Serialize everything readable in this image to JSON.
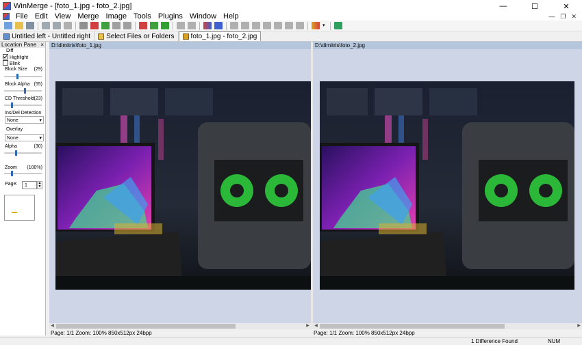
{
  "window": {
    "title": "WinMerge - [foto_1.jpg - foto_2.jpg]",
    "minimize": "—",
    "maximize": "☐",
    "close": "✕"
  },
  "menu": [
    "File",
    "Edit",
    "View",
    "Merge",
    "Image",
    "Tools",
    "Plugins",
    "Window",
    "Help"
  ],
  "mdi": {
    "minimize": "—",
    "restore": "❐",
    "close": "✕"
  },
  "tabs": [
    {
      "label": "Untitled left - Untitled right",
      "icon": "compare-icon"
    },
    {
      "label": "Select Files or Folders",
      "icon": "folder-icon"
    },
    {
      "label": "foto_1.jpg - foto_2.jpg",
      "icon": "image-compare-icon"
    }
  ],
  "location_pane": {
    "title": "Location Pane",
    "close": "×",
    "diff_label": "Diff",
    "highlight_label": "Highlight",
    "highlight_checked": true,
    "blink_label": "Blink",
    "blink_checked": false,
    "block_size": {
      "label": "Block Size",
      "value": "(29)",
      "level": 0.35
    },
    "block_alpha": {
      "label": "Block Alpha",
      "value": "(55)",
      "level": 0.55
    },
    "cd_threshold": {
      "label": "CD Threshold",
      "value": "(23)",
      "level": 0.2
    },
    "insdel_label": "Ins/Del Detection",
    "insdel_value": "None",
    "overlay_label": "Overlay",
    "overlay_value": "None",
    "alpha": {
      "label": "Alpha",
      "value": "(30)",
      "level": 0.3
    },
    "zoom": {
      "label": "Zoom",
      "value": "(100%)",
      "level": 0.2
    },
    "page_label": "Page:",
    "page_value": "1"
  },
  "left_pane": {
    "path": "D:\\dimitris\\foto_1.jpg",
    "status": "Page: 1/1  Zoom: 100%  850x512px  24bpp"
  },
  "right_pane": {
    "path": "D:\\dimitris\\foto_2.jpg",
    "status": "Page: 1/1  Zoom: 100%  850x512px  24bpp"
  },
  "statusbar": {
    "diff_count": "1 Difference Found",
    "num": "NUM"
  },
  "colors": {
    "pane_bg": "#cdd5e6",
    "pane_header": "#b5c6dc",
    "diff_highlight": "#d8b030"
  }
}
